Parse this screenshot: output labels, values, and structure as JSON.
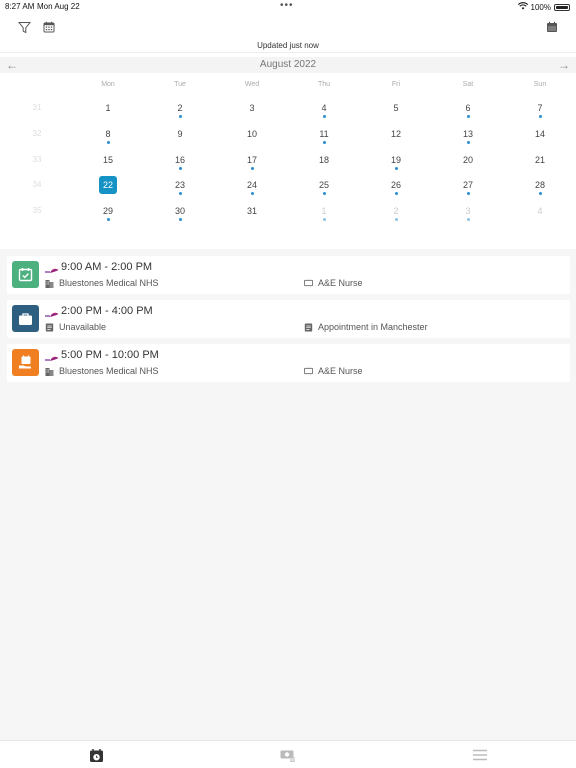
{
  "status": {
    "time": "8:27 AM",
    "date": "Mon Aug 22",
    "battery": "100%",
    "battery_level": 1.0
  },
  "toolbar": {
    "left_icons": [
      "filter-icon",
      "calendar-grid-icon"
    ],
    "right_icon": "calendar-icon"
  },
  "updated_text": "Updated just now",
  "calendar": {
    "month_label": "August 2022",
    "prev_icon": "arrow-left-icon",
    "next_icon": "arrow-right-icon",
    "weekdays": [
      "Mon",
      "Tue",
      "Wed",
      "Thu",
      "Fri",
      "Sat",
      "Sun"
    ],
    "weeks": [
      {
        "week": "31",
        "days": [
          {
            "n": "1",
            "dot": false,
            "muted": false
          },
          {
            "n": "2",
            "dot": true,
            "muted": false
          },
          {
            "n": "3",
            "dot": false,
            "muted": false
          },
          {
            "n": "4",
            "dot": true,
            "muted": false
          },
          {
            "n": "5",
            "dot": false,
            "muted": false
          },
          {
            "n": "6",
            "dot": true,
            "muted": false
          },
          {
            "n": "7",
            "dot": true,
            "muted": false
          }
        ]
      },
      {
        "week": "32",
        "days": [
          {
            "n": "8",
            "dot": true,
            "muted": false
          },
          {
            "n": "9",
            "dot": false,
            "muted": false
          },
          {
            "n": "10",
            "dot": false,
            "muted": false
          },
          {
            "n": "11",
            "dot": true,
            "muted": false
          },
          {
            "n": "12",
            "dot": false,
            "muted": false
          },
          {
            "n": "13",
            "dot": true,
            "muted": false
          },
          {
            "n": "14",
            "dot": false,
            "muted": false
          }
        ]
      },
      {
        "week": "33",
        "days": [
          {
            "n": "15",
            "dot": false,
            "muted": false
          },
          {
            "n": "16",
            "dot": true,
            "muted": false
          },
          {
            "n": "17",
            "dot": true,
            "muted": false
          },
          {
            "n": "18",
            "dot": false,
            "muted": false
          },
          {
            "n": "19",
            "dot": true,
            "muted": false
          },
          {
            "n": "20",
            "dot": false,
            "muted": false
          },
          {
            "n": "21",
            "dot": false,
            "muted": false
          }
        ]
      },
      {
        "week": "34",
        "days": [
          {
            "n": "22",
            "dot": false,
            "muted": false,
            "selected": true
          },
          {
            "n": "23",
            "dot": true,
            "muted": false
          },
          {
            "n": "24",
            "dot": true,
            "muted": false
          },
          {
            "n": "25",
            "dot": true,
            "muted": false
          },
          {
            "n": "26",
            "dot": true,
            "muted": false
          },
          {
            "n": "27",
            "dot": true,
            "muted": false
          },
          {
            "n": "28",
            "dot": true,
            "muted": false
          }
        ]
      },
      {
        "week": "35",
        "days": [
          {
            "n": "29",
            "dot": true,
            "muted": false
          },
          {
            "n": "30",
            "dot": true,
            "muted": false
          },
          {
            "n": "31",
            "dot": false,
            "muted": false
          },
          {
            "n": "1",
            "dot": true,
            "muted": true
          },
          {
            "n": "2",
            "dot": true,
            "muted": true
          },
          {
            "n": "3",
            "dot": true,
            "muted": true
          },
          {
            "n": "4",
            "dot": false,
            "muted": true
          }
        ]
      }
    ]
  },
  "events": [
    {
      "time": "9:00 AM - 2:00 PM",
      "color": "#4cb07f",
      "icon": "calendar-check-icon",
      "left_icon": "building-icon",
      "left_text": "Bluestones Medical NHS",
      "right_icon": "badge-card-icon",
      "right_text": "A&E Nurse"
    },
    {
      "time": "2:00 PM - 4:00 PM",
      "color": "#2e5f80",
      "icon": "briefcase-icon",
      "left_icon": "note-icon",
      "left_text": "Unavailable",
      "right_icon": "note-icon",
      "right_text": "Appointment in Manchester"
    },
    {
      "time": "5:00 PM - 10:00 PM",
      "color": "#ef7f21",
      "icon": "calendar-hand-icon",
      "left_icon": "building-icon",
      "left_text": "Bluestones Medical NHS",
      "right_icon": "badge-card-icon",
      "right_text": "A&E Nurse"
    }
  ],
  "tabbar": {
    "tabs": [
      "calendar-clock-icon",
      "money-icon",
      "menu-icon"
    ],
    "active_index": 0
  }
}
